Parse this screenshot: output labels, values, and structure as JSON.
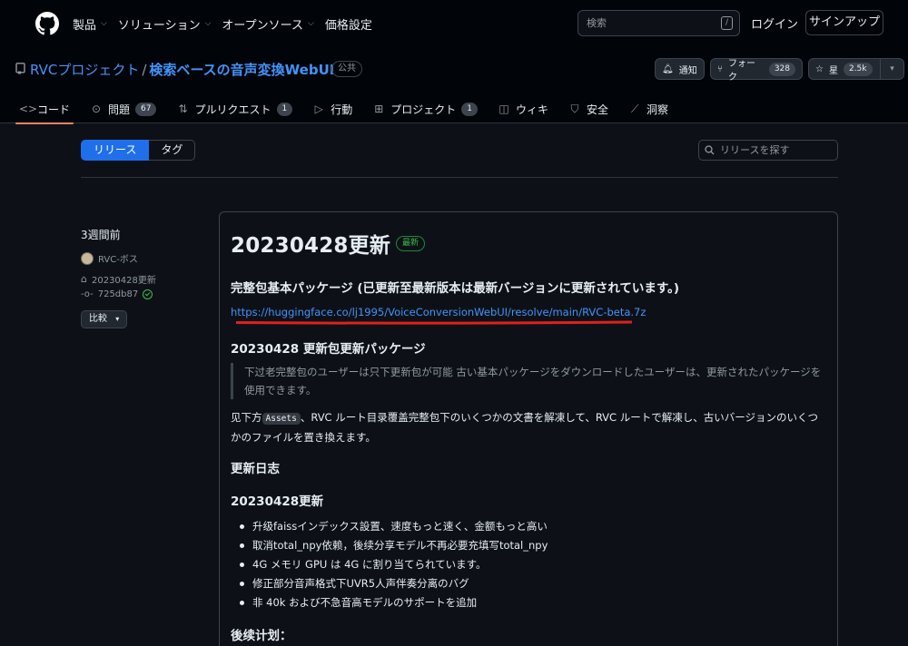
{
  "header": {
    "nav": [
      {
        "label": "製品"
      },
      {
        "label": "ソリューション"
      },
      {
        "label": "オープンソース"
      },
      {
        "label": "価格設定"
      }
    ],
    "search_placeholder": "検索",
    "search_shortcut": "/",
    "login": "ログイン",
    "signup": "サインアップ"
  },
  "repo": {
    "owner": "RVCプロジェクト",
    "separator": "/",
    "name": "検索ベースの音声変換WebUI",
    "visibility": "公共",
    "notify_label": "通知",
    "fork_label": "フォーク",
    "fork_count": "328",
    "star_label": "星",
    "star_count": "2.5k"
  },
  "tabs": [
    {
      "label": "コード",
      "icon": "code-icon",
      "active": true
    },
    {
      "label": "問題",
      "icon": "issue-icon",
      "count": "67"
    },
    {
      "label": "プルリクエスト",
      "icon": "pull-request-icon",
      "count": "1"
    },
    {
      "label": "行動",
      "icon": "play-icon"
    },
    {
      "label": "プロジェクト",
      "icon": "table-icon",
      "count": "1"
    },
    {
      "label": "ウィキ",
      "icon": "book-icon"
    },
    {
      "label": "安全",
      "icon": "shield-icon"
    },
    {
      "label": "洞察",
      "icon": "graph-icon"
    }
  ],
  "subnav": {
    "releases": "リリース",
    "tags": "タグ",
    "search_placeholder": "リリースを探す"
  },
  "release_meta": {
    "when": "3週間前",
    "author": "RVC-ボス",
    "tag": "20230428更新",
    "commit": "725db87",
    "compare": "比較"
  },
  "release": {
    "title": "20230428更新",
    "badge": "最新",
    "pkg_heading": "完整包基本パッケージ (已更新至最新版本は最新バージョンに更新されています。)",
    "link": "https://huggingface.co/lj1995/VoiceConversionWebUI/resolve/main/RVC-beta.7z",
    "update_heading": "20230428 更新包更新パッケージ",
    "quote": "下过老完整包のユーザーは只下更新包が可能 古い基本パッケージをダウンロードしたユーザーは、更新されたパッケージを使用できます。",
    "para_before": "见下方",
    "para_code": "Assets",
    "para_after": "、RVC ルート目录覆盖完整包下のいくつかの文書を解凍して、RVC ルートで解凍し、古いバージョンのいくつかのファイルを置き換えます。",
    "log_heading": "更新日志",
    "version_heading": "20230428更新",
    "items": [
      "升级faissインデックス設置、速度もっと速く、金额もっと高い",
      "取消total_npy依赖，後续分享モデル不再必要充填写total_npy",
      "4G メモリ GPU は 4G に割り当てられています。",
      "修正部分音声格式下UVR5人声伴奏分离のバグ",
      "非 40k および不急音高モデルのサポートを追加"
    ],
    "plan_heading": "後续计划："
  },
  "colors": {
    "accent": "#4493f8",
    "tab_underline": "#f78166",
    "latest_green": "#3fb950",
    "annotation_red": "#e0201b"
  }
}
